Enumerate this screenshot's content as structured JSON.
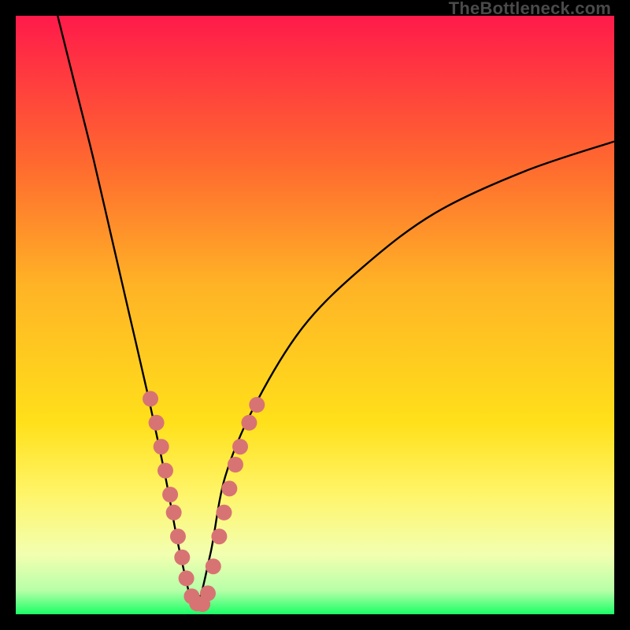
{
  "watermark": "TheBottleneck.com",
  "chart_data": {
    "type": "line",
    "title": "",
    "xlabel": "",
    "ylabel": "",
    "xlim": [
      0,
      100
    ],
    "ylim": [
      0,
      100
    ],
    "grid": false,
    "legend": false,
    "gradient_stops": [
      {
        "offset": 0,
        "color": "#ff1a4a"
      },
      {
        "offset": 0.25,
        "color": "#ff6a2f"
      },
      {
        "offset": 0.45,
        "color": "#ffb326"
      },
      {
        "offset": 0.68,
        "color": "#ffe01a"
      },
      {
        "offset": 0.8,
        "color": "#fff56a"
      },
      {
        "offset": 0.9,
        "color": "#f2ffb0"
      },
      {
        "offset": 0.96,
        "color": "#b8ffa8"
      },
      {
        "offset": 1.0,
        "color": "#1aff66"
      }
    ],
    "curve_description": "Asymmetric V-shaped percent-difference curve diving to zero near x ≈ 30 then rising more slowly on the right side",
    "series": [
      {
        "name": "bottleneck-curve",
        "x": [
          7,
          10,
          13,
          16,
          19,
          22,
          25,
          27.5,
          30,
          32.5,
          35,
          40,
          48,
          58,
          70,
          85,
          100
        ],
        "y": [
          100,
          88,
          76,
          63,
          50,
          37,
          23,
          10,
          1.5,
          10,
          23,
          35,
          48,
          58,
          67,
          74,
          79
        ]
      }
    ],
    "markers": {
      "name": "highlighted-points",
      "color": "#d87374",
      "radius": 10,
      "points": [
        {
          "x": 22.5,
          "y": 36
        },
        {
          "x": 23.5,
          "y": 32
        },
        {
          "x": 24.3,
          "y": 28
        },
        {
          "x": 25.0,
          "y": 24
        },
        {
          "x": 25.8,
          "y": 20
        },
        {
          "x": 26.4,
          "y": 17
        },
        {
          "x": 27.1,
          "y": 13
        },
        {
          "x": 27.8,
          "y": 9.5
        },
        {
          "x": 28.5,
          "y": 6
        },
        {
          "x": 29.4,
          "y": 3
        },
        {
          "x": 30.3,
          "y": 1.8
        },
        {
          "x": 31.2,
          "y": 1.7
        },
        {
          "x": 32.1,
          "y": 3.5
        },
        {
          "x": 33.0,
          "y": 8
        },
        {
          "x": 34.0,
          "y": 13
        },
        {
          "x": 34.8,
          "y": 17
        },
        {
          "x": 35.7,
          "y": 21
        },
        {
          "x": 36.7,
          "y": 25
        },
        {
          "x": 37.5,
          "y": 28
        },
        {
          "x": 39.0,
          "y": 32
        },
        {
          "x": 40.3,
          "y": 35
        }
      ]
    }
  }
}
